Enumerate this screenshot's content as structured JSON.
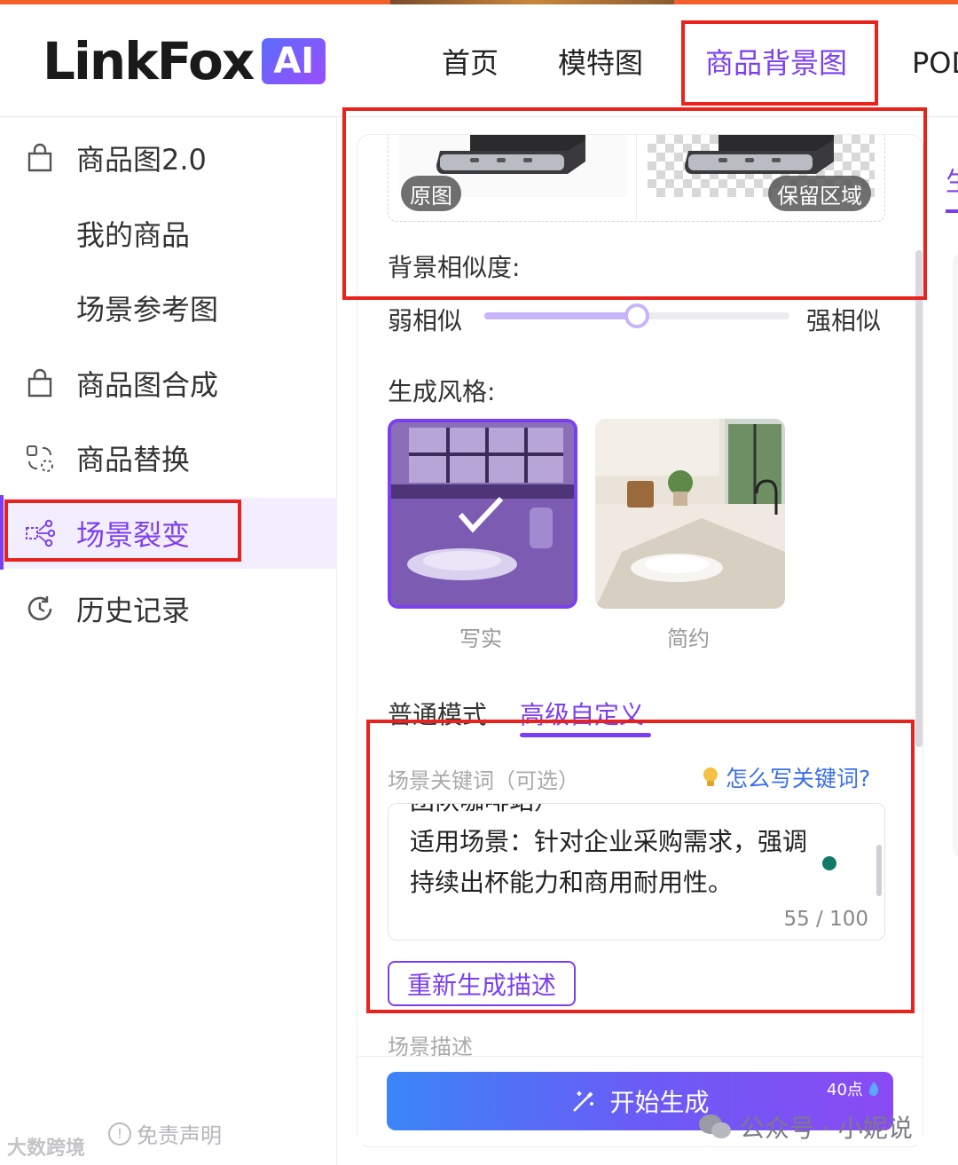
{
  "brand": {
    "name": "LinkFox",
    "badge": "AI"
  },
  "nav": {
    "items": [
      {
        "label": "首页"
      },
      {
        "label": "模特图"
      },
      {
        "label": "商品背景图"
      },
      {
        "label": "POD"
      }
    ],
    "active_index": 2
  },
  "sidebar": {
    "items": [
      {
        "label": "商品图2.0",
        "icon": "shopping-bag-icon"
      },
      {
        "label": "我的商品",
        "icon": ""
      },
      {
        "label": "场景参考图",
        "icon": ""
      },
      {
        "label": "商品图合成",
        "icon": "shopping-bag-icon"
      },
      {
        "label": "商品替换",
        "icon": "swap-icon"
      },
      {
        "label": "场景裂变",
        "icon": "fission-icon"
      },
      {
        "label": "历史记录",
        "icon": "history-clock-icon"
      }
    ],
    "active_index": 5,
    "disclaimer": "免责声明",
    "watermark": "大数跨境"
  },
  "images": {
    "original_tag": "原图",
    "keep_tag": "保留区域"
  },
  "similarity": {
    "label": "背景相似度:",
    "weak": "弱相似",
    "strong": "强相似",
    "value": 0.5
  },
  "style": {
    "label": "生成风格:",
    "options": [
      {
        "label": "写实",
        "selected": true
      },
      {
        "label": "简约",
        "selected": false
      }
    ]
  },
  "mode_tabs": {
    "normal": "普通模式",
    "advanced": "高级自定义",
    "active": "advanced"
  },
  "keywords": {
    "label": "场景关键词（可选）",
    "help": "怎么写关键词?",
    "text_line0": "团队咖啡站）",
    "text_line1": "适用场景：针对企业采购需求，强调",
    "text_line2": "持续出杯能力和商用耐用性。",
    "count": "55 / 100"
  },
  "regen_button": "重新生成描述",
  "scene_desc_label": "场景描述",
  "generate": {
    "label": "开始生成",
    "points": "40点"
  },
  "overlay_watermark": "公众号 · 小妮说",
  "right_partial_char": "生",
  "colors": {
    "accent": "#7b3ff2",
    "highlight_box": "#e8231d",
    "link": "#3a6fe8"
  }
}
